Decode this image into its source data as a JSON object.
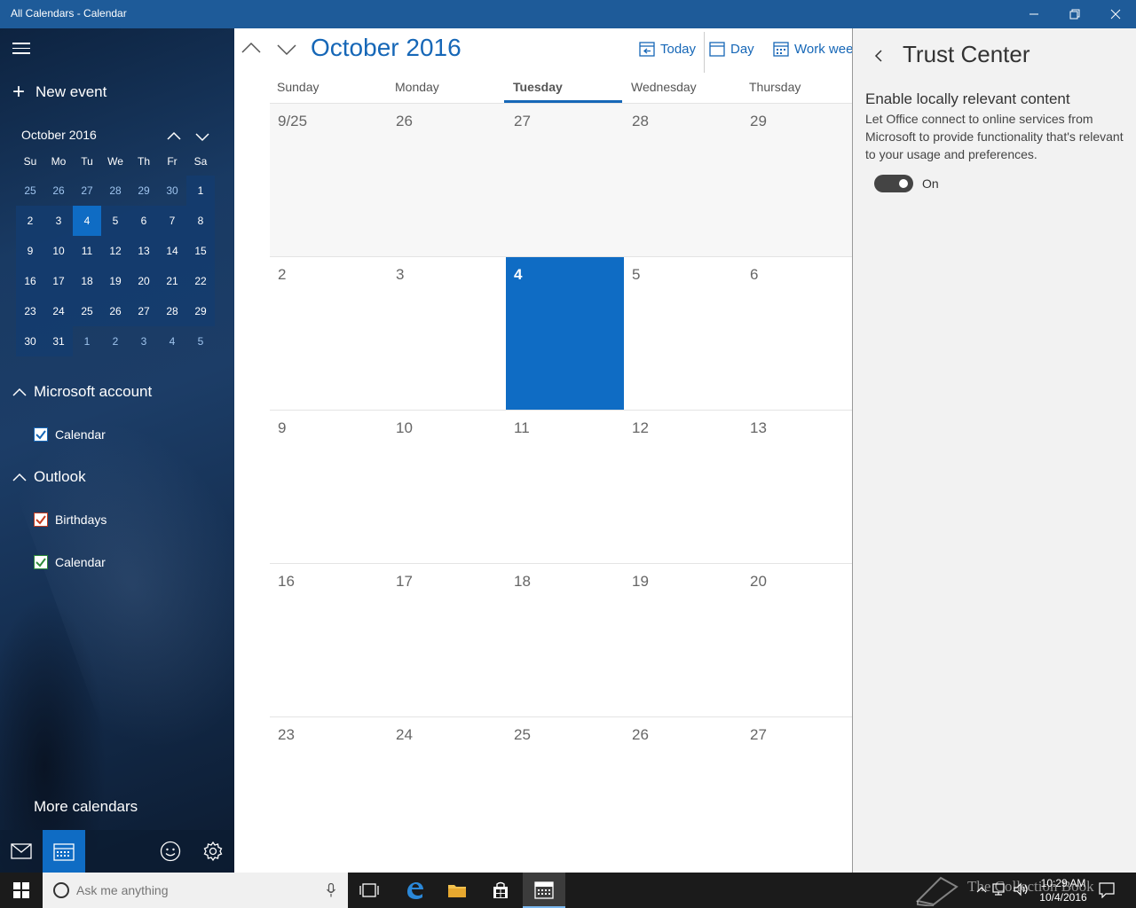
{
  "window": {
    "title": "All Calendars - Calendar"
  },
  "sidebar": {
    "new_event": "New event",
    "mini_calendar": {
      "month_label": "October 2016",
      "dow": [
        "Su",
        "Mo",
        "Tu",
        "We",
        "Th",
        "Fr",
        "Sa"
      ],
      "days": [
        "25",
        "26",
        "27",
        "28",
        "29",
        "30",
        "1",
        "2",
        "3",
        "4",
        "5",
        "6",
        "7",
        "8",
        "9",
        "10",
        "11",
        "12",
        "13",
        "14",
        "15",
        "16",
        "17",
        "18",
        "19",
        "20",
        "21",
        "22",
        "23",
        "24",
        "25",
        "26",
        "27",
        "28",
        "29",
        "30",
        "31",
        "1",
        "2",
        "3",
        "4",
        "5"
      ],
      "today_label": "4"
    },
    "sections": [
      {
        "label": "Microsoft account",
        "items": [
          {
            "label": "Calendar",
            "color": "#1667b7",
            "checked": true
          }
        ]
      },
      {
        "label": "Outlook",
        "items": [
          {
            "label": "Birthdays",
            "color": "#c53b1f",
            "checked": true
          },
          {
            "label": "Calendar",
            "color": "#2e8b3a",
            "checked": true
          }
        ]
      }
    ],
    "more_calendars": "More calendars",
    "bottom_icons": [
      "mail-icon",
      "calendar-icon",
      "feedback-icon",
      "gear-icon"
    ]
  },
  "main": {
    "month_title": "October 2016",
    "views": {
      "today": "Today",
      "day": "Day",
      "work_week": "Work week"
    },
    "dow": [
      "Sunday",
      "Monday",
      "Tuesday",
      "Wednesday",
      "Thursday"
    ],
    "active_dow": "Tuesday",
    "weeks": [
      [
        "9/25",
        "26",
        "27",
        "28",
        "29"
      ],
      [
        "2",
        "3",
        "4",
        "5",
        "6"
      ],
      [
        "9",
        "10",
        "11",
        "12",
        "13"
      ],
      [
        "16",
        "17",
        "18",
        "19",
        "20"
      ],
      [
        "23",
        "24",
        "25",
        "26",
        "27"
      ]
    ],
    "today": "4",
    "accent": "#1667b7"
  },
  "panel": {
    "title": "Trust Center",
    "heading": "Enable locally relevant content",
    "description": "Let Office connect to online services from Microsoft to provide functionality that's relevant to your usage and preferences.",
    "toggle_state": "On"
  },
  "taskbar": {
    "search_placeholder": "Ask me anything",
    "time": "10:29 AM",
    "date": "10/4/2016",
    "watermark": "The Collection Book"
  }
}
